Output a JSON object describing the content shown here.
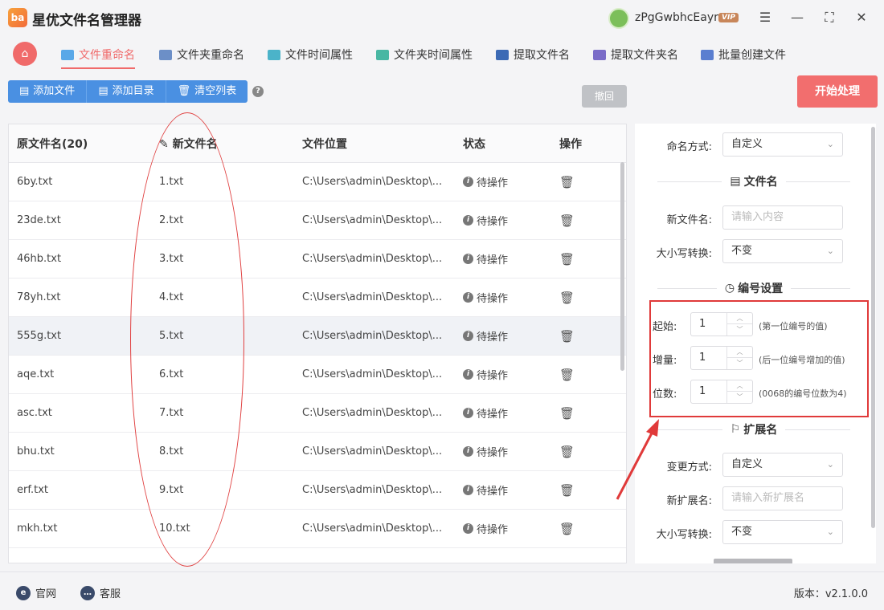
{
  "app": {
    "title": "星优文件名管理器",
    "logo": "ba"
  },
  "user": {
    "name": "zPgGwbhcEayr",
    "badge": "VIP"
  },
  "tabs": [
    {
      "label": "文件重命名",
      "icon": "rename-icon"
    },
    {
      "label": "文件夹重命名",
      "icon": "folder-rename-icon"
    },
    {
      "label": "文件时间属性",
      "icon": "file-time-icon"
    },
    {
      "label": "文件夹时间属性",
      "icon": "folder-time-icon"
    },
    {
      "label": "提取文件名",
      "icon": "extract-file-icon"
    },
    {
      "label": "提取文件夹名",
      "icon": "extract-folder-icon"
    },
    {
      "label": "批量创建文件",
      "icon": "batch-create-icon"
    }
  ],
  "toolbar": {
    "add_file": "添加文件",
    "add_dir": "添加目录",
    "clear_list": "清空列表",
    "undo": "撤回",
    "start": "开始处理"
  },
  "table": {
    "headers": {
      "orig": "原文件名(20)",
      "new": "新文件名",
      "path": "文件位置",
      "status": "状态",
      "op": "操作"
    },
    "rows": [
      {
        "orig": "6by.txt",
        "new": "1.txt",
        "path": "C:\\Users\\admin\\Desktop\\...",
        "status": "待操作"
      },
      {
        "orig": "23de.txt",
        "new": "2.txt",
        "path": "C:\\Users\\admin\\Desktop\\...",
        "status": "待操作"
      },
      {
        "orig": "46hb.txt",
        "new": "3.txt",
        "path": "C:\\Users\\admin\\Desktop\\...",
        "status": "待操作"
      },
      {
        "orig": "78yh.txt",
        "new": "4.txt",
        "path": "C:\\Users\\admin\\Desktop\\...",
        "status": "待操作"
      },
      {
        "orig": "555g.txt",
        "new": "5.txt",
        "path": "C:\\Users\\admin\\Desktop\\...",
        "status": "待操作"
      },
      {
        "orig": "aqe.txt",
        "new": "6.txt",
        "path": "C:\\Users\\admin\\Desktop\\...",
        "status": "待操作"
      },
      {
        "orig": "asc.txt",
        "new": "7.txt",
        "path": "C:\\Users\\admin\\Desktop\\...",
        "status": "待操作"
      },
      {
        "orig": "bhu.txt",
        "new": "8.txt",
        "path": "C:\\Users\\admin\\Desktop\\...",
        "status": "待操作"
      },
      {
        "orig": "erf.txt",
        "new": "9.txt",
        "path": "C:\\Users\\admin\\Desktop\\...",
        "status": "待操作"
      },
      {
        "orig": "mkh.txt",
        "new": "10.txt",
        "path": "C:\\Users\\admin\\Desktop\\...",
        "status": "待操作"
      }
    ]
  },
  "panel": {
    "naming_label": "命名方式:",
    "naming_value": "自定义",
    "sec_filename": "文件名",
    "newname_label": "新文件名:",
    "newname_placeholder": "请输入内容",
    "case_label": "大小写转换:",
    "case_value": "不变",
    "sec_number": "编号设置",
    "start_label": "起始:",
    "start_value": "1",
    "start_hint": "(第一位编号的值)",
    "inc_label": "增量:",
    "inc_value": "1",
    "inc_hint": "(后一位编号增加的值)",
    "digits_label": "位数:",
    "digits_value": "1",
    "digits_hint": "(0068的编号位数为4)",
    "sec_ext": "扩展名",
    "change_label": "变更方式:",
    "change_value": "自定义",
    "newext_label": "新扩展名:",
    "newext_placeholder": "请输入新扩展名",
    "case2_label": "大小写转换:",
    "case2_value": "不变"
  },
  "footer": {
    "website": "官网",
    "support": "客服",
    "version": "版本：v2.1.0.0"
  },
  "colors": {
    "accent": "#f06a6a",
    "primary": "#4a90e2",
    "annotation": "#e03a3a"
  }
}
